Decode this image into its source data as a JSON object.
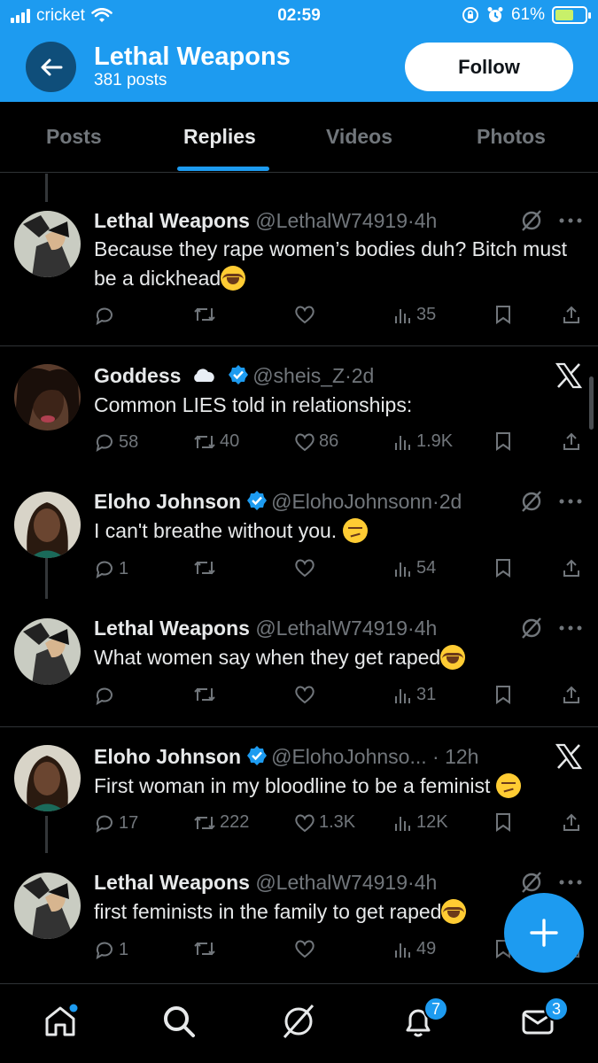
{
  "status_bar": {
    "carrier": "cricket",
    "time": "02:59",
    "battery": "61%"
  },
  "header": {
    "title": "Lethal Weapons",
    "subtitle": "381 posts",
    "follow_label": "Follow"
  },
  "tabs": [
    "Posts",
    "Replies",
    "Videos",
    "Photos"
  ],
  "active_tab": "Replies",
  "posts": [
    {
      "name": "Lethal Weapons",
      "handle": "@LethalW74919",
      "time": "4h",
      "verified": false,
      "text": "Because they rape women’s bodies duh? Bitch must be a dickhead",
      "emoji": "face-with-tears-of-joy",
      "replies": "",
      "reposts": "",
      "likes": "",
      "views": "35"
    },
    {
      "name": "Goddess",
      "handle": "@sheis_Z",
      "time": "2d",
      "verified": true,
      "name_emoji": "cloud",
      "text": "Common LIES told in relationships:",
      "replies": "58",
      "reposts": "40",
      "likes": "86",
      "views": "1.9K"
    },
    {
      "name": "Eloho Johnson",
      "handle": "@ElohoJohnsonn",
      "time": "2d",
      "verified": true,
      "text": "I can't breathe without you. ",
      "emoji": "woozy-face",
      "replies": "1",
      "reposts": "",
      "likes": "",
      "views": "54"
    },
    {
      "name": "Lethal Weapons",
      "handle": "@LethalW74919",
      "time": "4h",
      "verified": false,
      "text": "What women say when they get raped",
      "emoji": "face-with-tears-of-joy",
      "replies": "",
      "reposts": "",
      "likes": "",
      "views": "31"
    },
    {
      "name": "Eloho Johnson",
      "handle": "@ElohoJohnso...",
      "time": "12h",
      "verified": true,
      "text": "First woman in my bloodline to be a feminist ",
      "emoji": "woozy-face",
      "replies": "17",
      "reposts": "222",
      "likes": "1.3K",
      "views": "12K"
    },
    {
      "name": "Lethal Weapons",
      "handle": "@LethalW74919",
      "time": "4h",
      "verified": false,
      "text": "first feminists in the family to get raped",
      "emoji": "face-with-tears-of-joy",
      "replies": "1",
      "reposts": "",
      "likes": "",
      "views": "49"
    }
  ],
  "bottom_nav": {
    "items": [
      "home-icon",
      "search-icon",
      "grok-icon",
      "notifications-icon",
      "messages-icon"
    ],
    "notifications_badge": "7",
    "messages_badge": "3"
  },
  "colors": {
    "accent": "#1d9bf0",
    "background": "#000000",
    "muted": "#71767b"
  }
}
